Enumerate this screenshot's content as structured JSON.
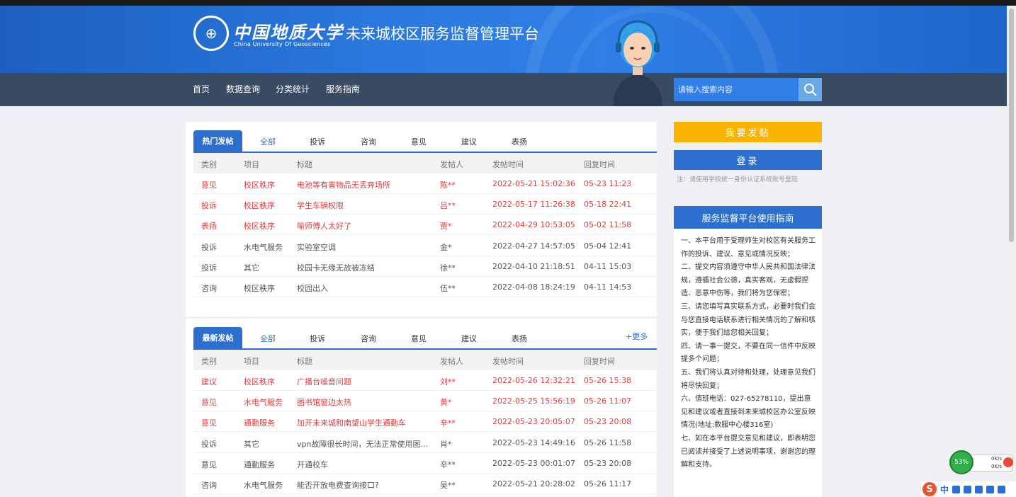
{
  "header": {
    "logo_cn": "中国地质大学",
    "logo_en": "China University Of Geosciences",
    "site_title": "未来城校区服务监督管理平台"
  },
  "nav": {
    "items": [
      "首页",
      "数据查询",
      "分类统计",
      "服务指南"
    ],
    "search_placeholder": "请输入搜索内容"
  },
  "hot_panel": {
    "active_tab": "热门发帖",
    "tabs": [
      "全部",
      "投诉",
      "咨询",
      "意见",
      "建议",
      "表扬"
    ],
    "columns": [
      "类别",
      "项目",
      "标题",
      "发帖人",
      "发帖时间",
      "回复时间"
    ],
    "rows": [
      {
        "type": "意见",
        "project": "校区秩序",
        "title": "电池等有害物品无丢弃场所",
        "author": "陈**",
        "post_time": "2022-05-21 15:02:36",
        "reply_time": "05-23 11:23",
        "hot": true
      },
      {
        "type": "投诉",
        "project": "校区秩序",
        "title": "学生车辆权限",
        "author": "吕**",
        "post_time": "2022-05-17 11:26:38",
        "reply_time": "05-18 22:41",
        "hot": true
      },
      {
        "type": "表扬",
        "project": "校区秩序",
        "title": "喻师傅人太好了",
        "author": "贾*",
        "post_time": "2022-04-29 10:53:05",
        "reply_time": "05-02 11:58",
        "hot": true
      },
      {
        "type": "投诉",
        "project": "水电气服务",
        "title": "实验室空调",
        "author": "金*",
        "post_time": "2022-04-27 14:57:05",
        "reply_time": "05-04 12:41",
        "hot": false
      },
      {
        "type": "投诉",
        "project": "其它",
        "title": "校园卡无缘无故被冻结",
        "author": "徐**",
        "post_time": "2022-04-10 21:18:51",
        "reply_time": "04-11 15:03",
        "hot": false
      },
      {
        "type": "咨询",
        "project": "校区秩序",
        "title": "校园出入",
        "author": "伍**",
        "post_time": "2022-04-08 18:24:19",
        "reply_time": "04-11 14:53",
        "hot": false
      }
    ]
  },
  "new_panel": {
    "active_tab": "最新发帖",
    "tabs": [
      "全部",
      "投诉",
      "咨询",
      "意见",
      "建议",
      "表扬"
    ],
    "more": "+更多",
    "columns": [
      "类别",
      "项目",
      "标题",
      "发帖人",
      "发帖时间",
      "回复时间"
    ],
    "rows": [
      {
        "type": "建议",
        "project": "校区秩序",
        "title": "广播台噪音问题",
        "author": "刘**",
        "post_time": "2022-05-26 12:32:21",
        "reply_time": "05-26 15:38",
        "hot": true
      },
      {
        "type": "意见",
        "project": "水电气服务",
        "title": "图书馆窗边太热",
        "author": "黄*",
        "post_time": "2022-05-25 15:56:19",
        "reply_time": "05-26 11:07",
        "hot": true
      },
      {
        "type": "意见",
        "project": "通勤服务",
        "title": "加开未来城和南望山学生通勤车",
        "author": "辛**",
        "post_time": "2022-05-23 20:05:07",
        "reply_time": "05-23 20:08",
        "hot": true
      },
      {
        "type": "投诉",
        "project": "其它",
        "title": "vpn故障很长时间，无法正常使用图...",
        "author": "肖*",
        "post_time": "2022-05-23 14:49:16",
        "reply_time": "05-26 11:58",
        "hot": false
      },
      {
        "type": "意见",
        "project": "通勤服务",
        "title": "开通校车",
        "author": "辛**",
        "post_time": "2022-05-23 00:01:07",
        "reply_time": "05-23 20:08",
        "hot": false
      },
      {
        "type": "咨询",
        "project": "水电气服务",
        "title": "能否开放电费查询接口?",
        "author": "吴**",
        "post_time": "2022-05-21 20:28:02",
        "reply_time": "05-26 11:17",
        "hot": false
      }
    ]
  },
  "sidebar": {
    "post_button": "我要发贴",
    "login_button": "登录",
    "login_note": "注：请使用学校统一身份认证系统账号登陆",
    "guide_title": "服务监督平台使用指南",
    "guide_items": [
      "一、本平台用于受理师生对校区有关服务工作的投诉、建议、意见或情况反映；",
      "二、提交内容须遵守中华人民共和国法律法规，遵循社会公德，真实客观，无虚假捏造、恶意中伤等，我们将为您保密；",
      "三、请您填写真实联系方式，必要时我们会与您直接电话联系进行相关情况的了解和核实，便于我们给您相关回复；",
      "四、请一事一提交，不要在同一信件中反映提多个问题；",
      "五、我们将认真对待和处理，处理意见我们将尽快回复；",
      "六、值班电话：027-65278110，提出意见和建议或者直接到未来城校区办公室反映情况(地址:数服中心楼316室)",
      "七、如在本平台提交意见和建议，即表明您已阅读并接受了上述说明事项，谢谢您的理解和支持。"
    ]
  },
  "system": {
    "net_percent": "53%",
    "net_up": "0K/s",
    "net_down": "0K/s",
    "ime_label": "中"
  },
  "colors": {
    "header_blue": "#2f7fe6",
    "nav_dark": "#394a63",
    "accent_blue": "#2d6fce",
    "hot_red": "#e23b3b",
    "post_yellow": "#f8b400"
  }
}
